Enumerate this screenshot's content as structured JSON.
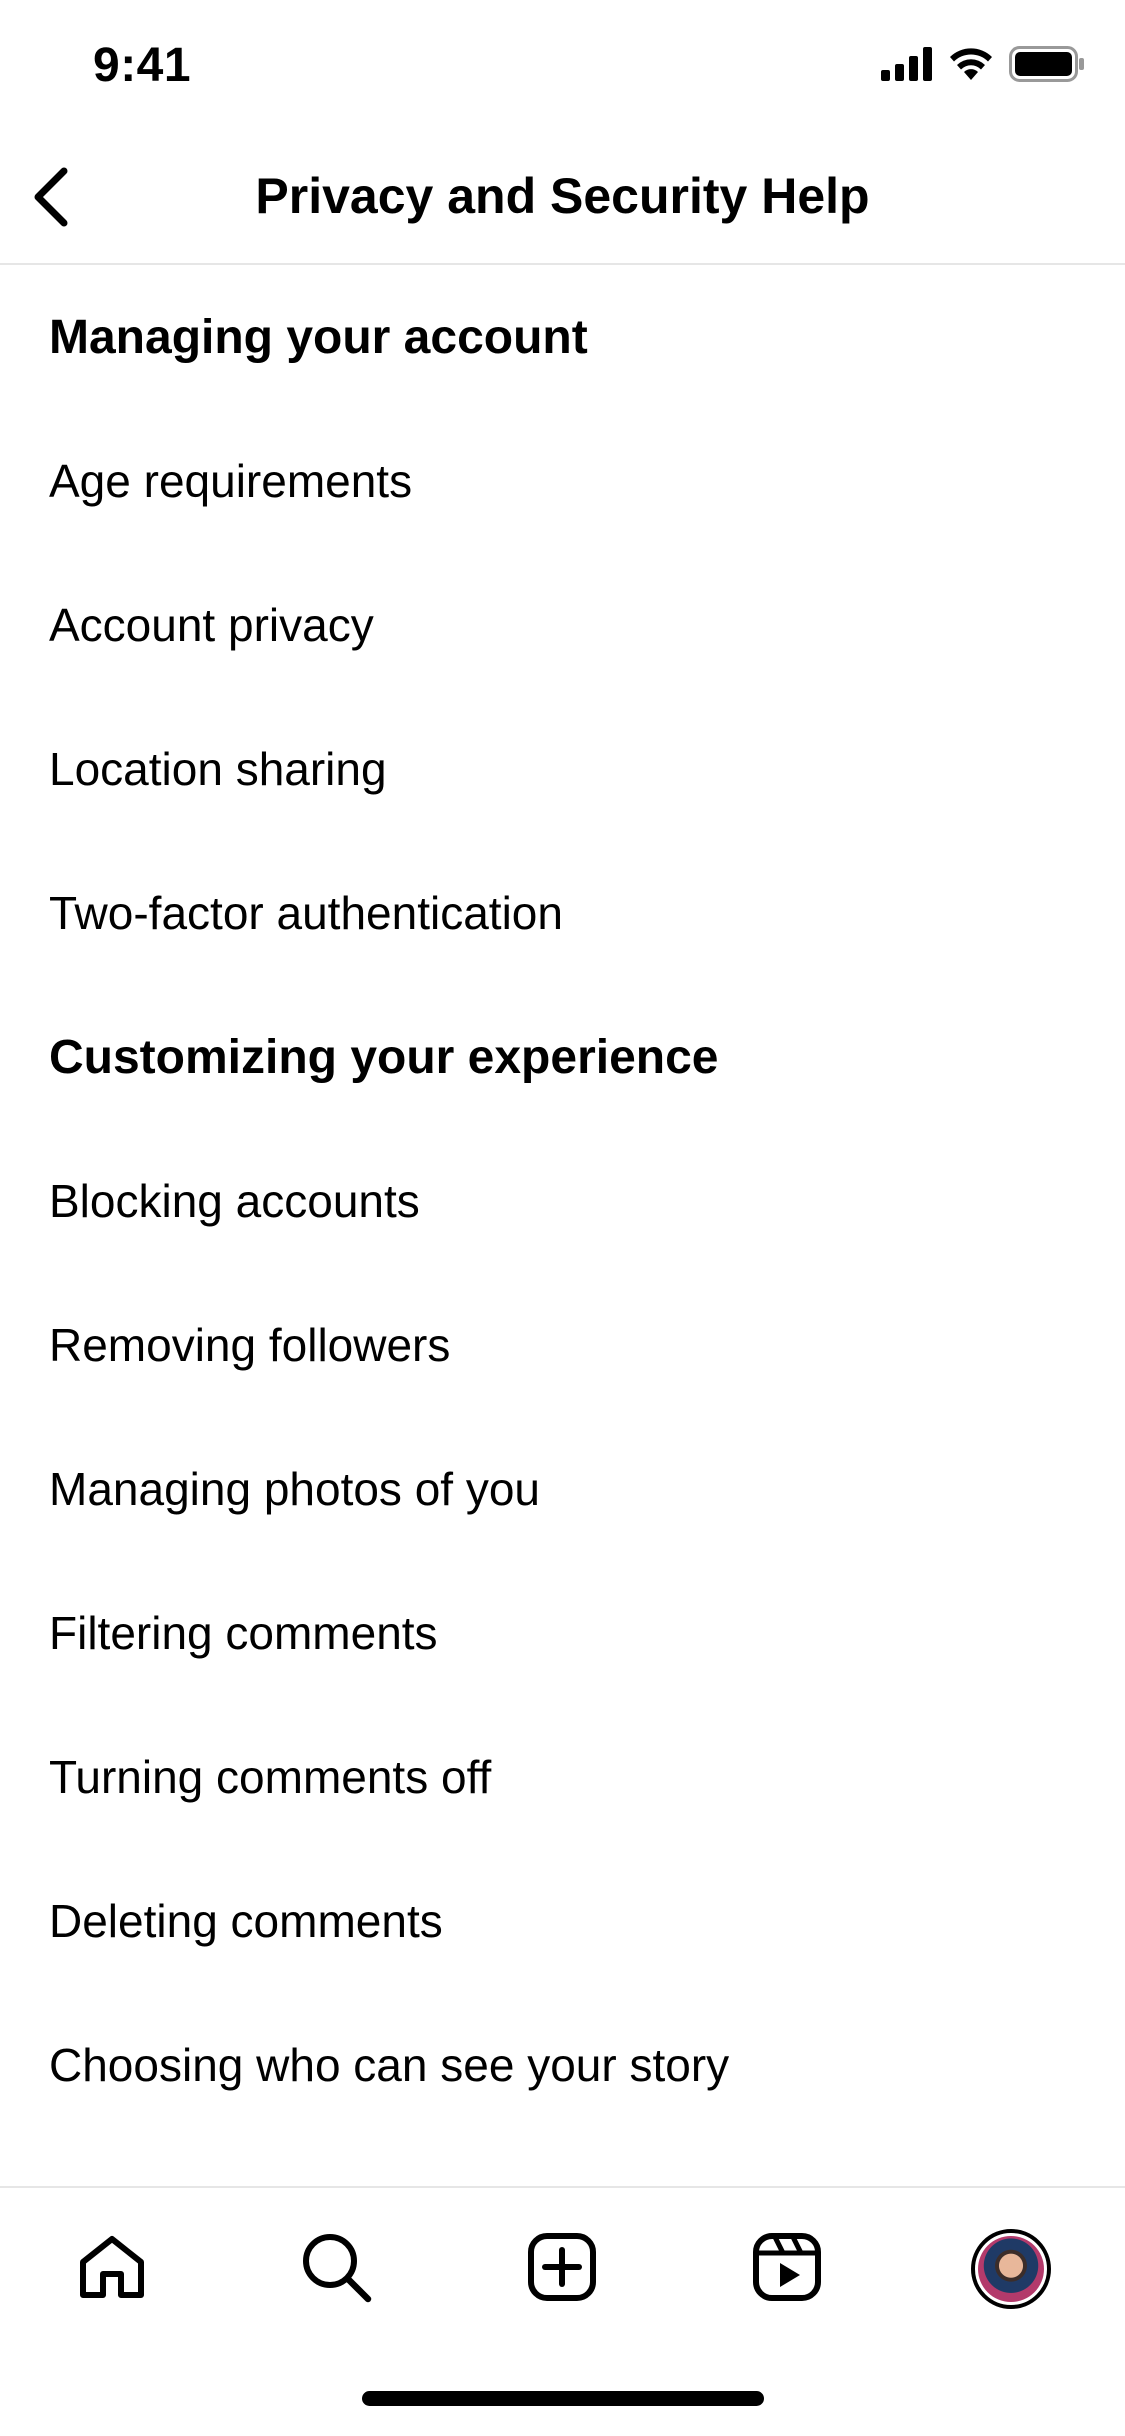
{
  "status_bar": {
    "time": "9:41",
    "icons": [
      "cellular-signal-icon",
      "wifi-icon",
      "battery-icon"
    ]
  },
  "header": {
    "title": "Privacy and Security Help",
    "back_icon": "chevron-left-icon"
  },
  "sections": [
    {
      "title": "Managing your account",
      "items": [
        "Age requirements",
        "Account privacy",
        "Location sharing",
        "Two-factor authentication"
      ]
    },
    {
      "title": "Customizing your experience",
      "items": [
        "Blocking accounts",
        "Removing followers",
        "Managing photos of you",
        "Filtering comments",
        "Turning comments off",
        "Deleting comments",
        "Choosing who can see your story"
      ]
    }
  ],
  "tab_bar": {
    "tabs": [
      "home-icon",
      "search-icon",
      "create-icon",
      "reels-icon",
      "profile-avatar"
    ]
  },
  "colors": {
    "background": "#ffffff",
    "text": "#000000",
    "divider": "#e6e6e6"
  }
}
